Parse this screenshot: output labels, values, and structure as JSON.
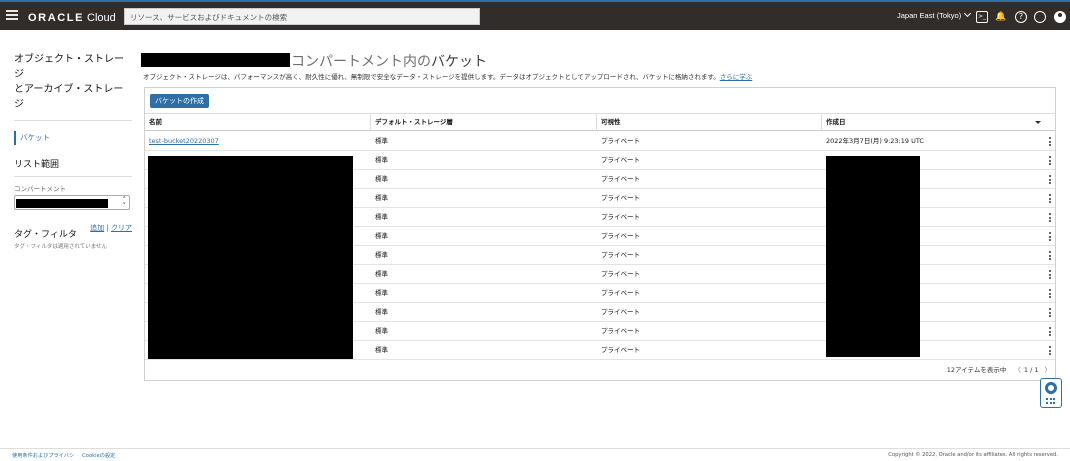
{
  "topbar": {
    "brand_oracle": "ORACLE",
    "brand_cloud": "Cloud",
    "search_placeholder": "リソース、サービスおよびドキュメントの検索",
    "region": "Japan East (Tokyo)",
    "icons": [
      "menu-icon",
      "cloud-shell-icon",
      "bell-icon",
      "help-icon",
      "globe-icon",
      "user-icon"
    ]
  },
  "sidebar": {
    "title_line1": "オブジェクト・ストレージ",
    "title_line2": "とアーカイブ・ストレージ",
    "nav_item": "バケット",
    "scope_title": "リスト範囲",
    "compartment_label": "コンパートメント",
    "tag_filter_title": "タグ・フィルタ",
    "tag_add": "追加",
    "tag_sep": "|",
    "tag_clear": "クリア",
    "tag_note": "タグ・フィルタは適用されていません"
  },
  "main": {
    "title_suffix": "コンパートメント内の",
    "title_emph": "バケット",
    "description": "オブジェクト・ストレージは、パフォーマンスが高く、耐久性に優れ、無制限で安全なデータ・ストレージを提供します。データはオブジェクトとしてアップロードされ、バケットに格納されます。",
    "learn_more": "さらに学ぶ",
    "create_button": "バケットの作成",
    "columns": [
      "名前",
      "デフォルト・ストレージ層",
      "可視性",
      "作成日"
    ],
    "rows": [
      {
        "name": "test-bucket20220307",
        "tier": "標準",
        "visibility": "プライベート",
        "created": "2022年3月7日(月) 9:23:19 UTC"
      },
      {
        "name": "",
        "tier": "標準",
        "visibility": "プライベート",
        "created": ""
      },
      {
        "name": "",
        "tier": "標準",
        "visibility": "プライベート",
        "created": ""
      },
      {
        "name": "",
        "tier": "標準",
        "visibility": "プライベート",
        "created": ""
      },
      {
        "name": "",
        "tier": "標準",
        "visibility": "プライベート",
        "created": ""
      },
      {
        "name": "",
        "tier": "標準",
        "visibility": "プライベート",
        "created": ""
      },
      {
        "name": "",
        "tier": "標準",
        "visibility": "プライベート",
        "created": ""
      },
      {
        "name": "",
        "tier": "標準",
        "visibility": "プライベート",
        "created": ""
      },
      {
        "name": "",
        "tier": "標準",
        "visibility": "プライベート",
        "created": ""
      },
      {
        "name": "",
        "tier": "標準",
        "visibility": "プライベート",
        "created": ""
      },
      {
        "name": "",
        "tier": "標準",
        "visibility": "プライベート",
        "created": ""
      },
      {
        "name": "",
        "tier": "標準",
        "visibility": "プライベート",
        "created": ""
      }
    ],
    "pager_text": "12アイテムを表示中",
    "pager_page": "1 / 1",
    "pager_prev": "〈",
    "pager_next": "〉"
  },
  "footer": {
    "terms": "使用条件およびプライバシ",
    "cookies": "Cookieの設定",
    "copyright": "Copyright © 2022, Oracle and/or its affiliates. All rights reserved."
  },
  "colors": {
    "topbar_bg": "#312d2a",
    "accent": "#2e6fa6",
    "redaction": "#000000"
  }
}
